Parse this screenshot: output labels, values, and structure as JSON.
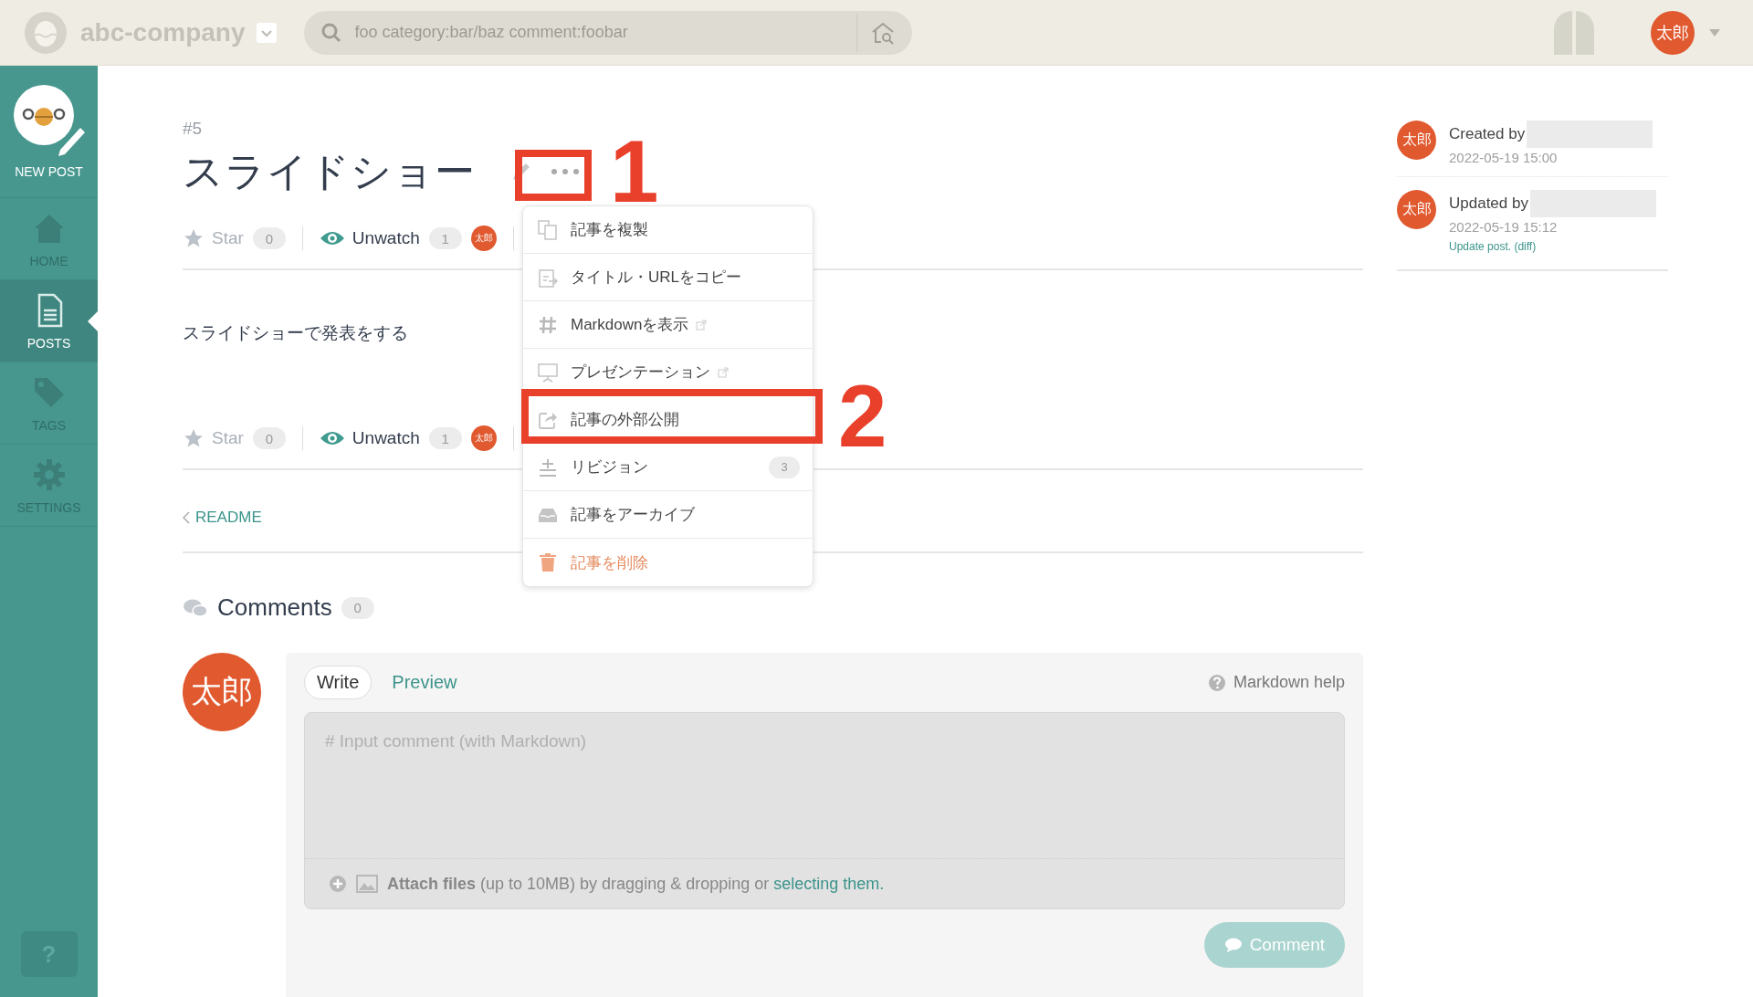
{
  "header": {
    "team": "abc-company",
    "search": {
      "placeholder": "foo category:bar/baz comment:foobar"
    },
    "user_avatar": "太郎"
  },
  "sidebar": {
    "items": [
      {
        "label": "NEW POST",
        "selected": false
      },
      {
        "label": "HOME",
        "selected": false
      },
      {
        "label": "POSTS",
        "selected": true
      },
      {
        "label": "TAGS",
        "selected": false
      },
      {
        "label": "SETTINGS",
        "selected": false
      }
    ],
    "help": "?"
  },
  "post": {
    "number": "#5",
    "title": "スライドショー",
    "body": "スライドショーで発表をする",
    "action_rows": [
      {
        "star": "Star",
        "star_count": "0",
        "watch": "Unwatch",
        "watch_count": "1",
        "watcher": "太郎"
      },
      {
        "star": "Star",
        "star_count": "0",
        "watch": "Unwatch",
        "watch_count": "1",
        "watcher": "太郎"
      }
    ],
    "prev_link": "README"
  },
  "menu": {
    "items": [
      {
        "label": "記事を複製",
        "kind": "normal",
        "external": false
      },
      {
        "label": "タイトル・URLをコピー",
        "kind": "normal",
        "external": false
      },
      {
        "label": "Markdownを表示",
        "kind": "normal",
        "external": true
      },
      {
        "label": "プレゼンテーション",
        "kind": "normal",
        "external": true
      },
      {
        "label": "記事の外部公開",
        "kind": "normal",
        "external": false
      },
      {
        "label": "リビジョン",
        "kind": "normal",
        "external": false,
        "badge": "3"
      },
      {
        "label": "記事をアーカイブ",
        "kind": "normal",
        "external": false
      },
      {
        "label": "記事を削除",
        "kind": "danger",
        "external": false
      }
    ]
  },
  "annotations": [
    {
      "label": "1"
    },
    {
      "label": "2"
    }
  ],
  "meta": [
    {
      "label": "Created by",
      "time": "2022-05-19 15:00",
      "avatar": "太郎"
    },
    {
      "label": "Updated by",
      "time": "2022-05-19 15:12",
      "avatar": "太郎",
      "message": "Update post. (diff)"
    }
  ],
  "comments": {
    "title": "Comments",
    "count": "0",
    "avatar": "太郎",
    "tabs": [
      {
        "label": "Write",
        "selected": true
      },
      {
        "label": "Preview",
        "selected": false
      }
    ],
    "help": "Markdown help",
    "placeholder": "# Input comment (with Markdown)",
    "attach_text": "**Attach files** (up to 10MB) by dragging & dropping or",
    "attach_link": "selecting them.",
    "button": {
      "label": "Comment",
      "disabled": true
    }
  }
}
